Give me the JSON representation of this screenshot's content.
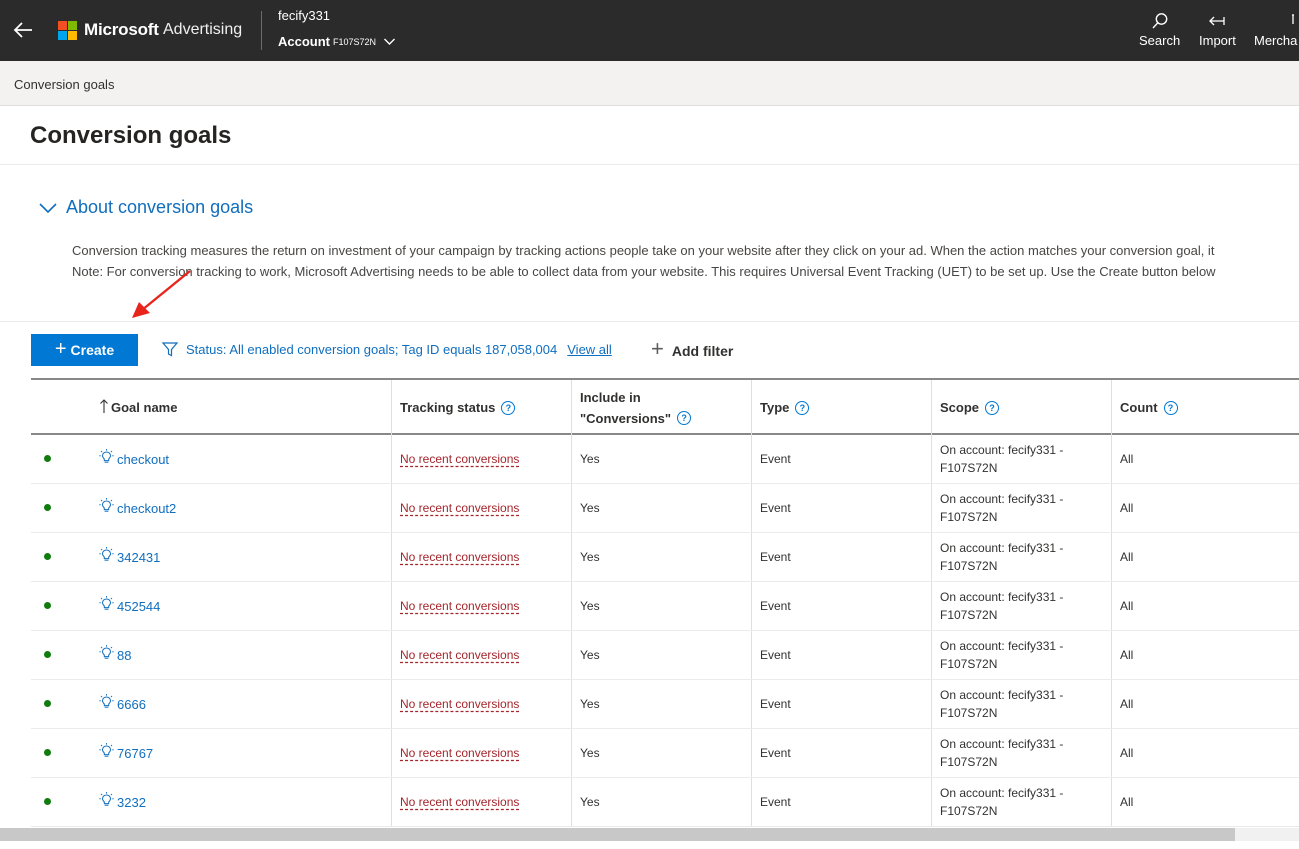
{
  "header": {
    "brand_name": "Microsoft",
    "brand_product": "Advertising",
    "account_user": "fecify331",
    "account_label": "Account",
    "account_id": "F107S72N",
    "nav": [
      {
        "label": "Search",
        "icon": "search-icon"
      },
      {
        "label": "Import",
        "icon": "import-icon"
      },
      {
        "label": "Mercha",
        "icon": "merchant-icon"
      }
    ],
    "logo_colors": [
      "#f25022",
      "#7fba00",
      "#00a4ef",
      "#ffb900"
    ]
  },
  "breadcrumb": "Conversion goals",
  "page_title": "Conversion goals",
  "about": {
    "title": "About conversion goals",
    "line1": "Conversion tracking measures the return on investment of your campaign by tracking actions people take on your website after they click on your ad. When the action matches your conversion goal, it",
    "line2": "Note: For conversion tracking to work, Microsoft Advertising needs to be able to collect data from your website. This requires Universal Event Tracking (UET) to be set up. Use the Create button below"
  },
  "toolbar": {
    "create_label": "Create",
    "filter_text": "Status: All enabled conversion goals; Tag ID equals 187,058,004",
    "view_all": "View all",
    "add_filter": "Add filter"
  },
  "table": {
    "columns": {
      "goal_name": "Goal name",
      "tracking_status": "Tracking status",
      "include_line1": "Include in",
      "include_line2": "\"Conversions\"",
      "type": "Type",
      "scope": "Scope",
      "count": "Count"
    },
    "rows": [
      {
        "name": "checkout",
        "tracking": "No recent conversions",
        "include": "Yes",
        "type": "Event",
        "scope1": "On account: fecify331 -",
        "scope2": "F107S72N",
        "count": "All"
      },
      {
        "name": "checkout2",
        "tracking": "No recent conversions",
        "include": "Yes",
        "type": "Event",
        "scope1": "On account: fecify331 -",
        "scope2": "F107S72N",
        "count": "All"
      },
      {
        "name": "342431",
        "tracking": "No recent conversions",
        "include": "Yes",
        "type": "Event",
        "scope1": "On account: fecify331 -",
        "scope2": "F107S72N",
        "count": "All"
      },
      {
        "name": "452544",
        "tracking": "No recent conversions",
        "include": "Yes",
        "type": "Event",
        "scope1": "On account: fecify331 -",
        "scope2": "F107S72N",
        "count": "All"
      },
      {
        "name": "88",
        "tracking": "No recent conversions",
        "include": "Yes",
        "type": "Event",
        "scope1": "On account: fecify331 -",
        "scope2": "F107S72N",
        "count": "All"
      },
      {
        "name": "6666",
        "tracking": "No recent conversions",
        "include": "Yes",
        "type": "Event",
        "scope1": "On account: fecify331 -",
        "scope2": "F107S72N",
        "count": "All"
      },
      {
        "name": "76767",
        "tracking": "No recent conversions",
        "include": "Yes",
        "type": "Event",
        "scope1": "On account: fecify331 -",
        "scope2": "F107S72N",
        "count": "All"
      },
      {
        "name": "3232",
        "tracking": "No recent conversions",
        "include": "Yes",
        "type": "Event",
        "scope1": "On account: fecify331 -",
        "scope2": "F107S72N",
        "count": "All"
      }
    ]
  }
}
